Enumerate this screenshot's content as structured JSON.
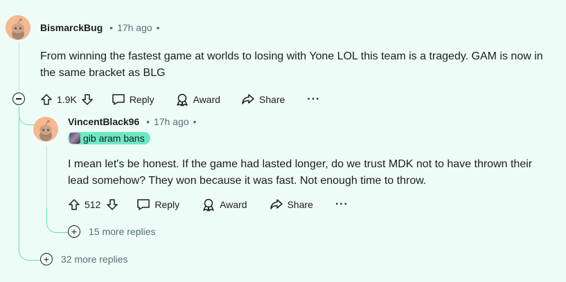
{
  "comment1": {
    "username": "BismarckBug",
    "timestamp": "17h ago",
    "body": "From winning the fastest game at worlds to losing with Yone LOL this team is a tragedy. GAM is now in the same bracket as BLG",
    "votes": "1.9K",
    "reply_label": "Reply",
    "award_label": "Award",
    "share_label": "Share",
    "more_replies": "32 more replies"
  },
  "comment2": {
    "username": "VincentBlack96",
    "timestamp": "17h ago",
    "flair": "gib aram bans",
    "body": "I mean let's be honest. If the game had lasted longer, do we trust MDK not to have thrown their lead somehow? They won because it was fast. Not enough time to throw.",
    "votes": "512",
    "reply_label": "Reply",
    "award_label": "Award",
    "share_label": "Share",
    "more_replies": "15 more replies"
  },
  "colors": {
    "background": "#eefcf8",
    "accent": "#5be3bd",
    "flair": "#6de8c6",
    "avatar": "#f5b88f"
  }
}
